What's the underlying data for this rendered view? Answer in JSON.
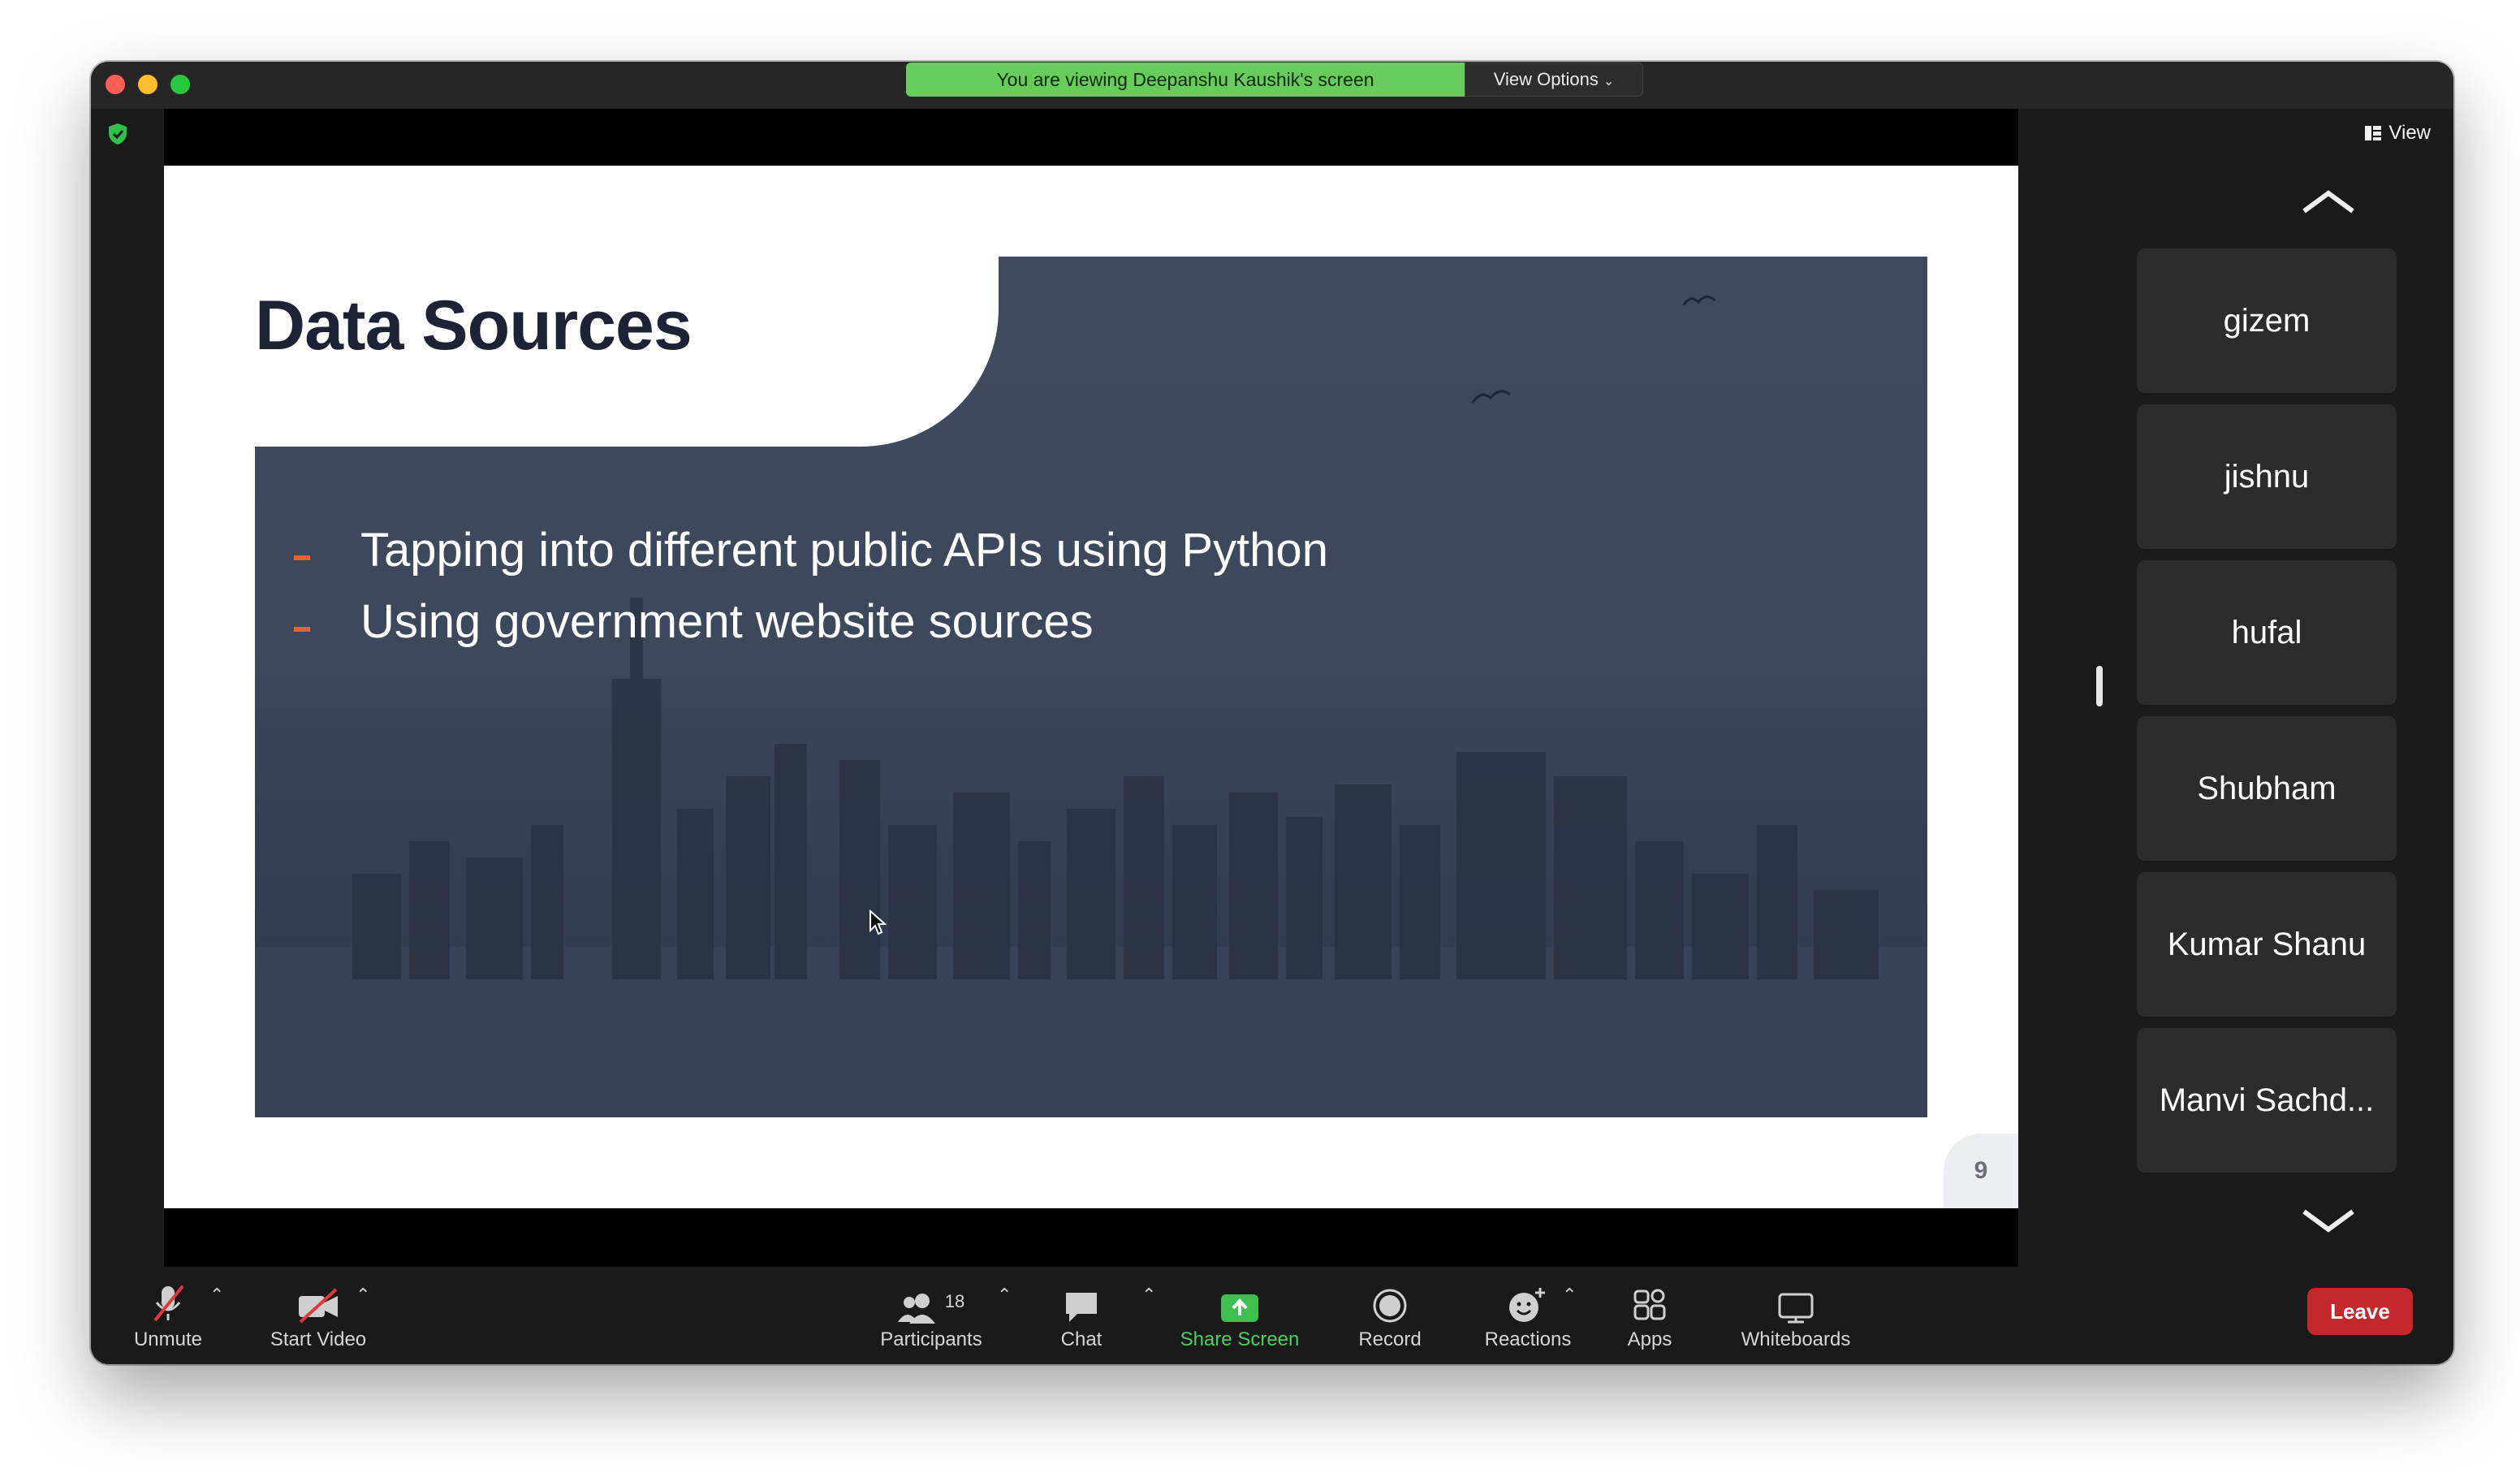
{
  "banner": {
    "viewing_text": "You are viewing Deepanshu Kaushik's screen",
    "view_options_label": "View Options"
  },
  "header": {
    "view_label": "View"
  },
  "slide": {
    "title": "Data Sources",
    "bullets": [
      "Tapping into different public APIs using Python",
      "Using government website sources"
    ],
    "page_number": "9"
  },
  "participants_panel": {
    "names": [
      "gizem",
      "jishnu",
      "hufal",
      "Shubham",
      "Kumar Shanu",
      "Manvi Sachd..."
    ]
  },
  "toolbar": {
    "unmute": "Unmute",
    "start_video": "Start Video",
    "participants": "Participants",
    "participants_count": "18",
    "chat": "Chat",
    "share_screen": "Share Screen",
    "record": "Record",
    "reactions": "Reactions",
    "apps": "Apps",
    "whiteboards": "Whiteboards",
    "leave": "Leave"
  },
  "colors": {
    "share_green": "#67cc5b",
    "leave_red": "#c4282c",
    "bullet_orange": "#f0622b",
    "slide_overlay": "#3e485c"
  }
}
